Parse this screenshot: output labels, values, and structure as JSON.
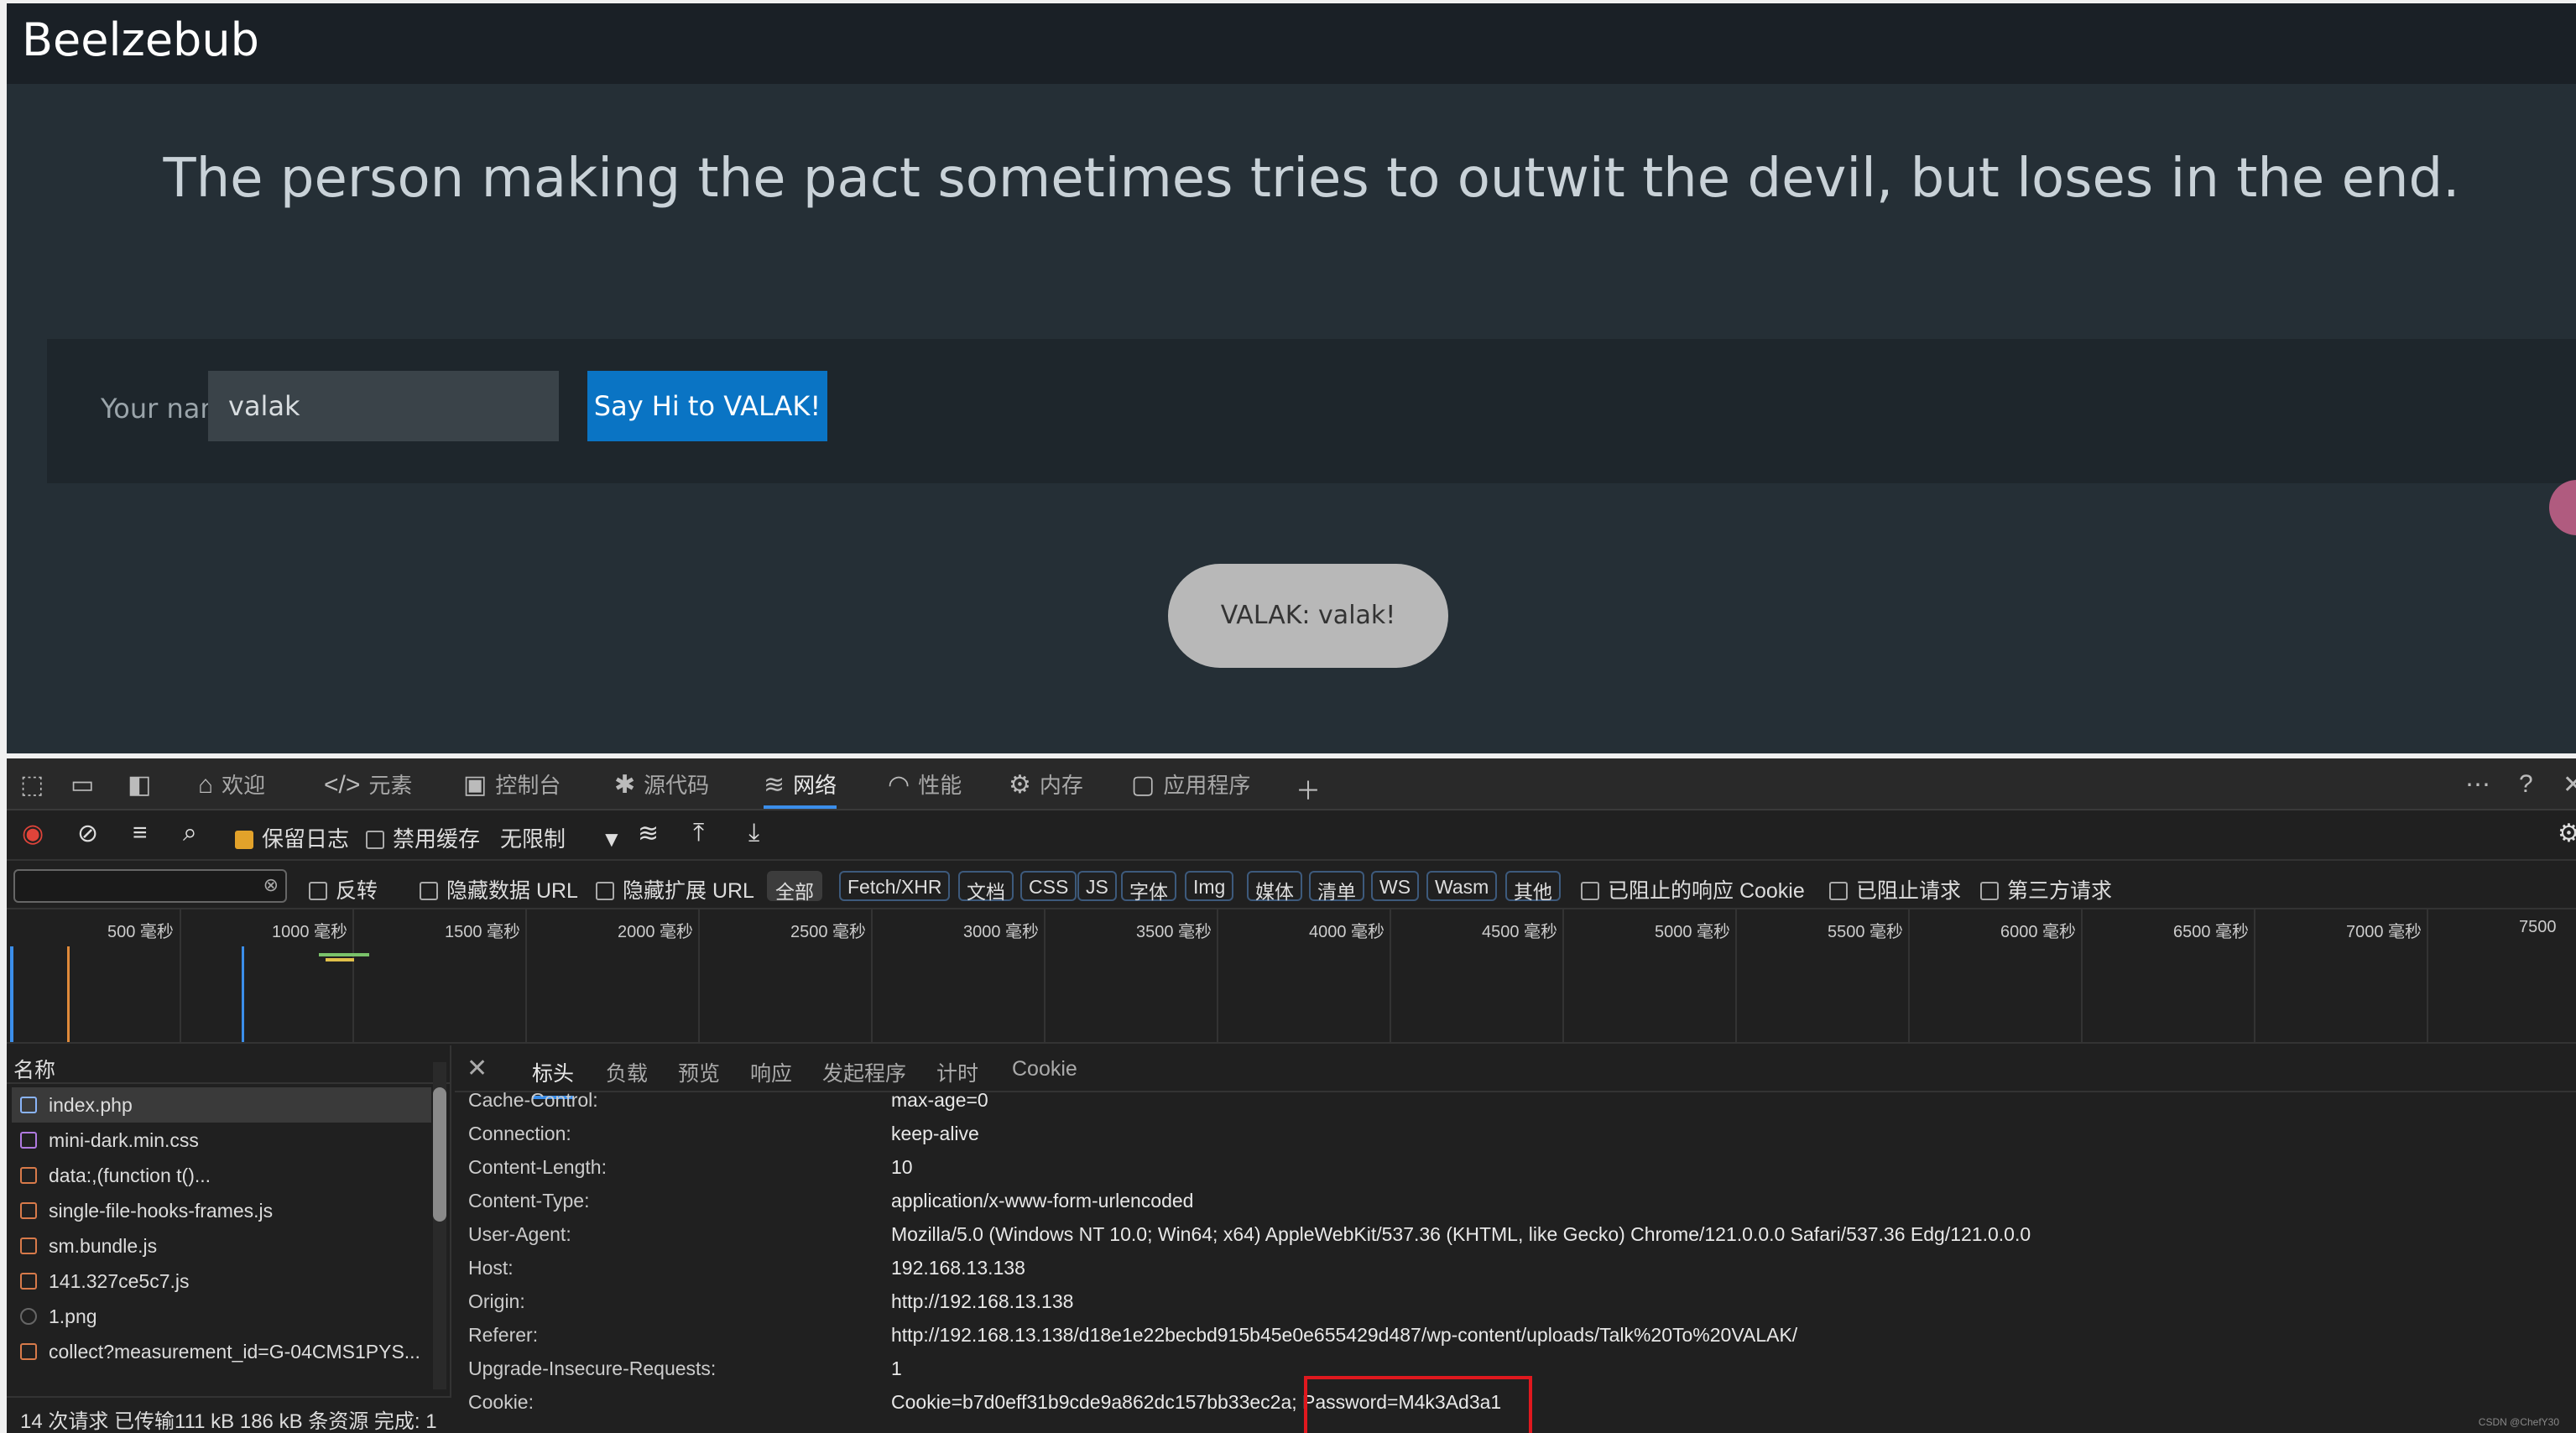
{
  "page": {
    "brand": "Beelzebub",
    "headline": "The person making the pact sometimes tries to outwit the devil, but loses in the end.",
    "form": {
      "label": "Your name:",
      "value": "valak",
      "button": "Say Hi to VALAK!"
    },
    "bubble": "VALAK: valak!"
  },
  "devtools": {
    "tabs": [
      "欢迎",
      "元素",
      "控制台",
      "源代码",
      "网络",
      "性能",
      "内存",
      "应用程序"
    ],
    "active_tab": "网络",
    "toolbar": {
      "preserve_log": "保留日志",
      "disable_cache": "禁用缓存",
      "throttle": "无限制"
    },
    "filters": {
      "invert": "反转",
      "hide_data_urls": "隐藏数据 URL",
      "hide_ext_urls": "隐藏扩展 URL",
      "chips": [
        "全部",
        "Fetch/XHR",
        "文档",
        "CSS",
        "JS",
        "字体",
        "Img",
        "媒体",
        "清单",
        "WS",
        "Wasm",
        "其他"
      ],
      "blocked_cookies": "已阻止的响应 Cookie",
      "blocked_requests": "已阻止请求",
      "third_party": "第三方请求"
    },
    "timeline_ticks": [
      "500 毫秒",
      "1000 毫秒",
      "1500 毫秒",
      "2000 毫秒",
      "2500 毫秒",
      "3000 毫秒",
      "3500 毫秒",
      "4000 毫秒",
      "4500 毫秒",
      "5000 毫秒",
      "5500 毫秒",
      "6000 毫秒",
      "6500 毫秒",
      "7000 毫秒",
      "7500"
    ],
    "requests_header": "名称",
    "requests": [
      "index.php",
      "mini-dark.min.css",
      "data:,(function t()...",
      "single-file-hooks-frames.js",
      "sm.bundle.js",
      "141.327ce5c7.js",
      "1.png",
      "collect?measurement_id=G-04CMS1PYS..."
    ],
    "status": "14 次请求  已传输111 kB  186 kB 条资源  完成: 1",
    "detail_tabs": [
      "标头",
      "负载",
      "预览",
      "响应",
      "发起程序",
      "计时",
      "Cookie"
    ],
    "headers": [
      {
        "name": "Cache-Control:",
        "value": "max-age=0"
      },
      {
        "name": "Connection:",
        "value": "keep-alive"
      },
      {
        "name": "Content-Length:",
        "value": "10"
      },
      {
        "name": "Content-Type:",
        "value": "application/x-www-form-urlencoded"
      },
      {
        "name": "Cookie:",
        "value": "Cookie=b7d0eff31b9cde9a862dc157bb33ec2a; Password=M4k3Ad3a1"
      },
      {
        "name": "Host:",
        "value": "192.168.13.138"
      },
      {
        "name": "Origin:",
        "value": "http://192.168.13.138"
      },
      {
        "name": "Referer:",
        "value": "http://192.168.13.138/d18e1e22becbd915b45e0e655429d487/wp-content/uploads/Talk%20To%20VALAK/"
      },
      {
        "name": "Upgrade-Insecure-Requests:",
        "value": "1"
      },
      {
        "name": "User-Agent:",
        "value": "Mozilla/5.0 (Windows NT 10.0; Win64; x64) AppleWebKit/537.36 (KHTML, like Gecko) Chrome/121.0.0.0 Safari/537.36 Edg/121.0.0.0"
      }
    ],
    "watermark": "CSDN @ChefY30",
    "colors": {
      "accent": "#3b8eea",
      "highlight": "#e0181e",
      "button": "#0a74c4"
    }
  }
}
